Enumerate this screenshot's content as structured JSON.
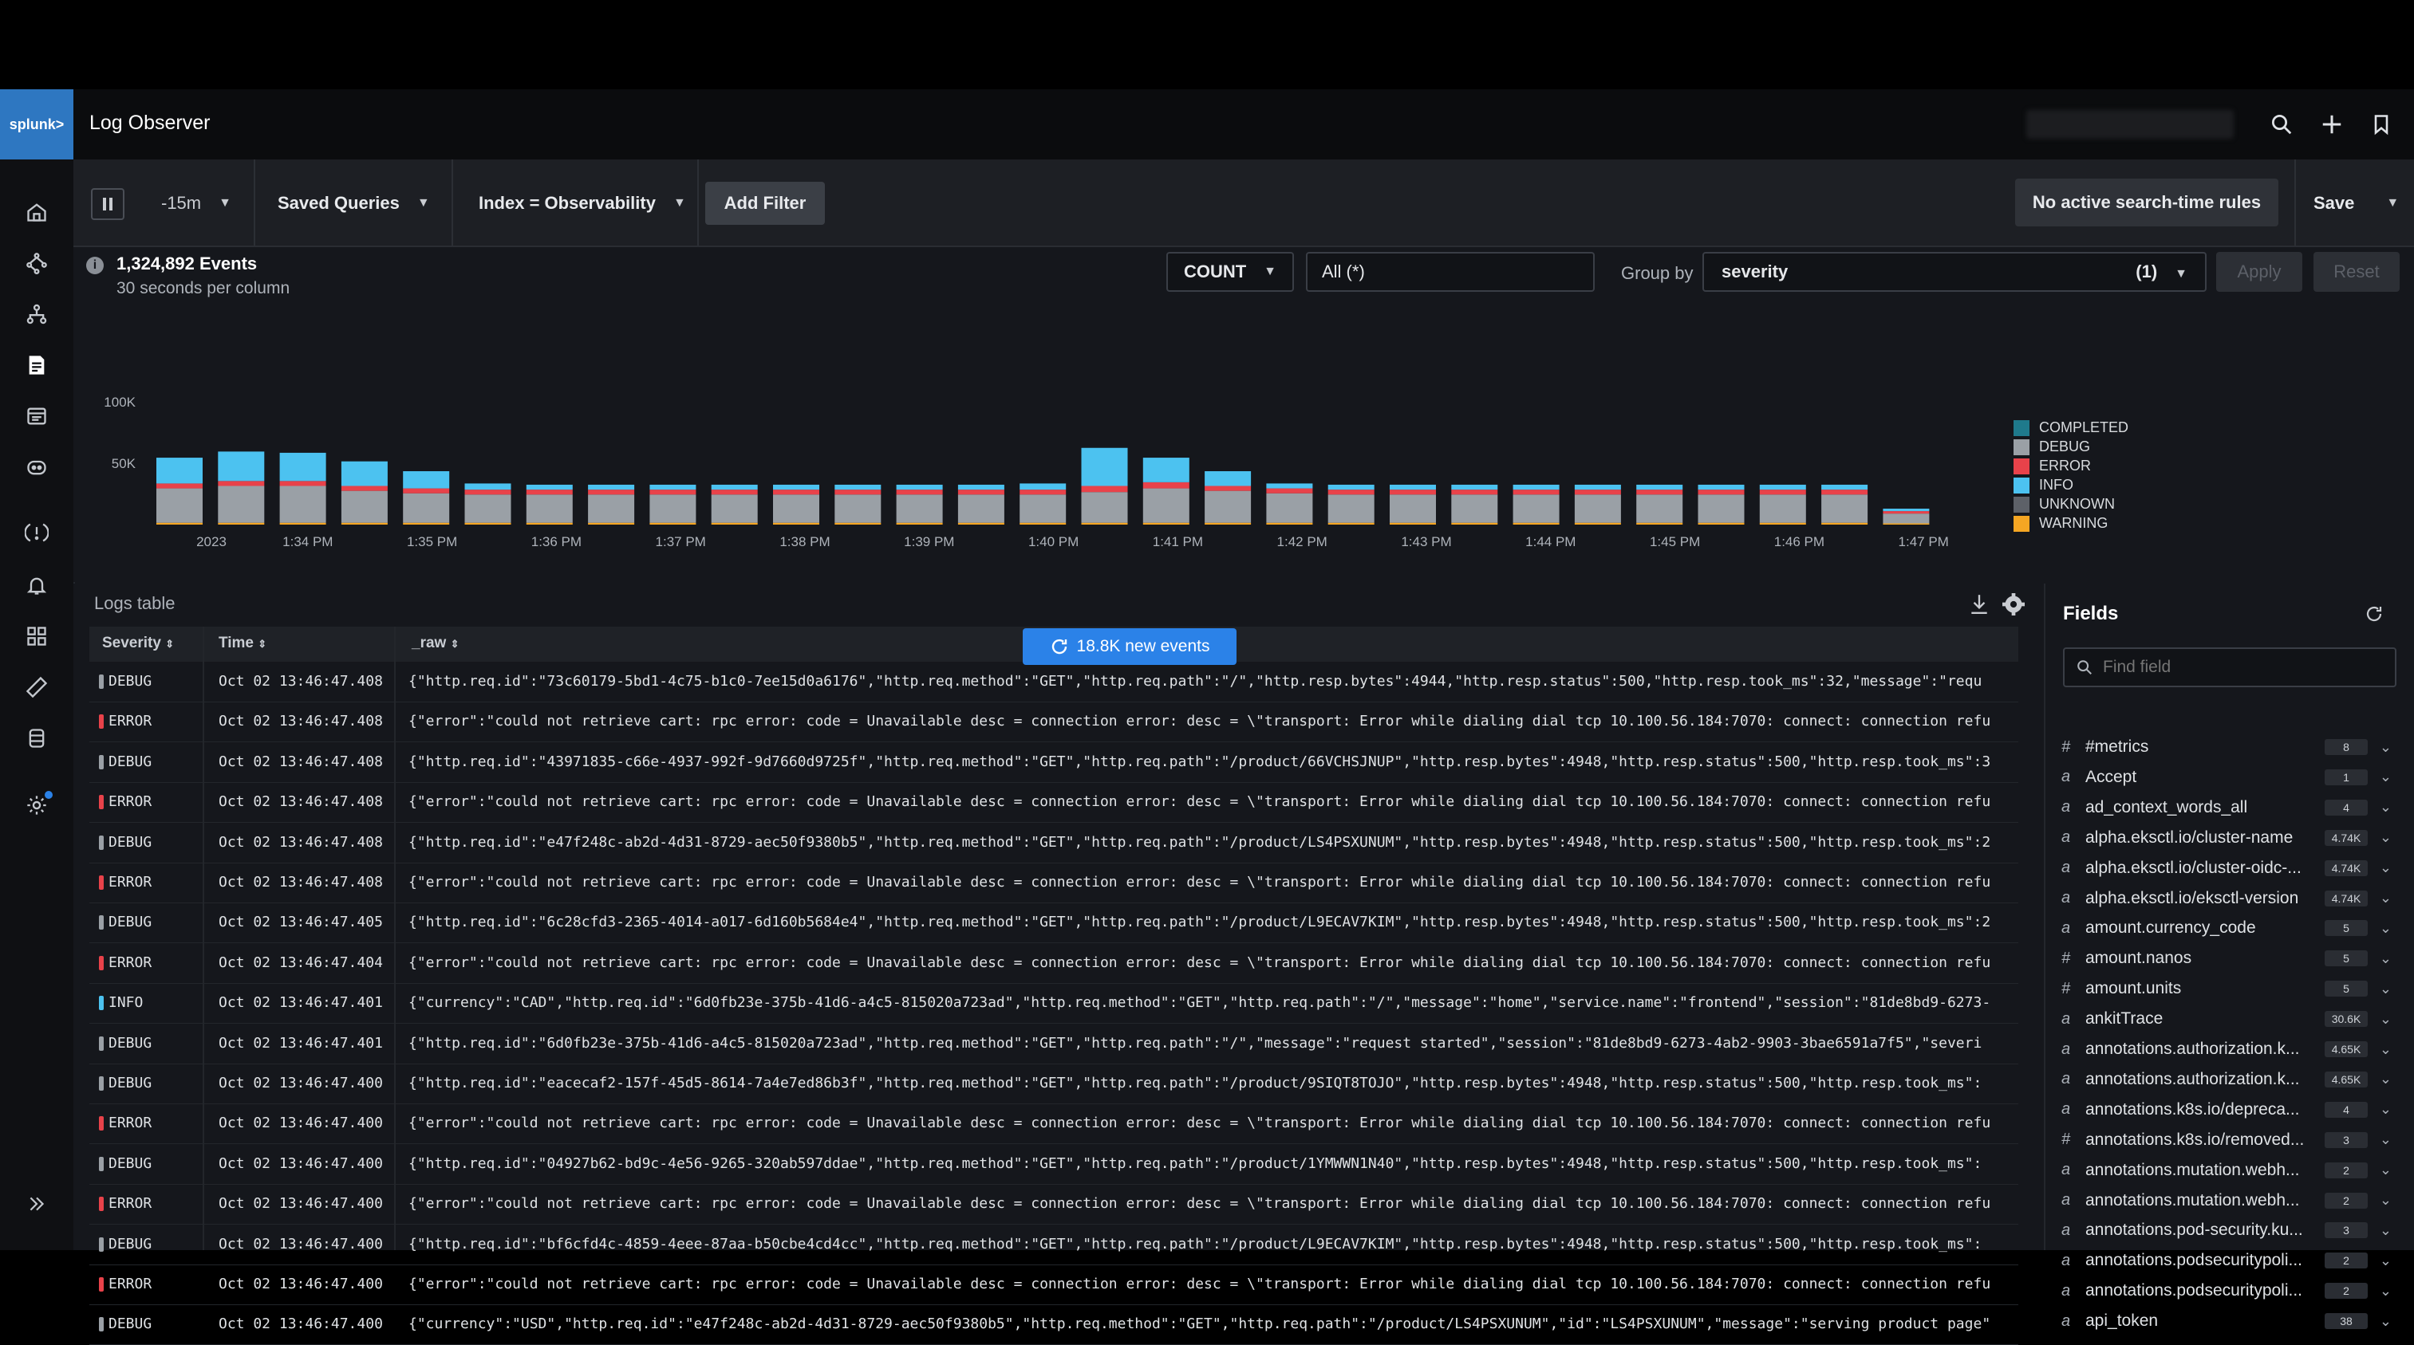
{
  "header": {
    "logo": "splunk>",
    "title": "Log Observer"
  },
  "toolbar": {
    "time_range": "-15m",
    "saved_queries": "Saved Queries",
    "index": "Index = Observability",
    "add_filter": "Add Filter",
    "rules": "No active search-time rules",
    "save": "Save"
  },
  "summary": {
    "events": "1,324,892 Events",
    "per_column": "30 seconds per column",
    "agg": "COUNT",
    "agg_target": "All (*)",
    "group_by_label": "Group by",
    "group_by": "severity",
    "group_by_count": "(1)",
    "apply": "Apply",
    "reset": "Reset"
  },
  "chart_data": {
    "type": "bar",
    "stacked": true,
    "y_ticks": [
      "100K",
      "50K"
    ],
    "ylim": [
      0,
      100000
    ],
    "x_tick_labels": [
      "2023",
      "1:34 PM",
      "1:35 PM",
      "1:36 PM",
      "1:37 PM",
      "1:38 PM",
      "1:39 PM",
      "1:40 PM",
      "1:41 PM",
      "1:42 PM",
      "1:43 PM",
      "1:44 PM",
      "1:45 PM",
      "1:46 PM",
      "1:47 PM"
    ],
    "series": [
      {
        "name": "COMPLETED",
        "color": "#1f7a8c",
        "values": [
          0,
          0,
          0,
          0,
          0,
          0,
          0,
          0,
          0,
          0,
          0,
          0,
          0,
          0,
          0,
          0,
          0,
          0,
          0,
          0,
          0,
          0,
          0,
          0,
          0,
          0,
          0,
          0,
          0
        ]
      },
      {
        "name": "DEBUG",
        "color": "#9aa0a6",
        "values": [
          28000,
          30000,
          30000,
          26000,
          24000,
          23000,
          23000,
          23000,
          23000,
          23000,
          23000,
          23000,
          23000,
          23000,
          23000,
          25000,
          28000,
          26000,
          24000,
          23000,
          23000,
          23000,
          23000,
          23000,
          23000,
          23000,
          23000,
          23000,
          8000
        ]
      },
      {
        "name": "ERROR",
        "color": "#e8424a",
        "values": [
          4000,
          4000,
          4000,
          4000,
          4000,
          4000,
          4000,
          4000,
          4000,
          4000,
          4000,
          4000,
          4000,
          4000,
          4000,
          5000,
          5000,
          4000,
          4000,
          4000,
          4000,
          4000,
          4000,
          4000,
          4000,
          4000,
          4000,
          4000,
          2000
        ]
      },
      {
        "name": "INFO",
        "color": "#4cc2f0",
        "values": [
          21000,
          24000,
          23000,
          20000,
          14000,
          5000,
          4000,
          4000,
          4000,
          4000,
          4000,
          4000,
          4000,
          4000,
          5000,
          31000,
          20000,
          12000,
          4000,
          4000,
          4000,
          4000,
          4000,
          4000,
          4000,
          4000,
          4000,
          4000,
          2000
        ]
      },
      {
        "name": "UNKNOWN",
        "color": "#5d6168",
        "values": [
          0,
          0,
          0,
          0,
          0,
          0,
          0,
          0,
          0,
          0,
          0,
          0,
          0,
          0,
          0,
          0,
          0,
          0,
          0,
          0,
          0,
          0,
          0,
          0,
          0,
          0,
          0,
          0,
          0
        ]
      },
      {
        "name": "WARNING",
        "color": "#f5a623",
        "values": [
          1500,
          1500,
          1500,
          1500,
          1500,
          1500,
          1500,
          1500,
          1500,
          1500,
          1500,
          1500,
          1500,
          1500,
          1500,
          1500,
          1500,
          1500,
          1500,
          1500,
          1500,
          1500,
          1500,
          1500,
          1500,
          1500,
          1500,
          1500,
          1000
        ]
      }
    ]
  },
  "logs": {
    "title": "Logs table",
    "columns": [
      "Severity",
      "Time",
      "_raw"
    ],
    "new_events": "18.8K new events",
    "rows": [
      {
        "severity": "DEBUG",
        "time": "Oct 02 13:46:47.408",
        "raw": "{\"http.req.id\":\"73c60179-5bd1-4c75-b1c0-7ee15d0a6176\",\"http.req.method\":\"GET\",\"http.req.path\":\"/\",\"http.resp.bytes\":4944,\"http.resp.status\":500,\"http.resp.took_ms\":32,\"message\":\"requ"
      },
      {
        "severity": "ERROR",
        "time": "Oct 02 13:46:47.408",
        "raw": "{\"error\":\"could not retrieve cart: rpc error: code = Unavailable desc = connection error: desc = \\\"transport: Error while dialing dial tcp 10.100.56.184:7070: connect: connection refu"
      },
      {
        "severity": "DEBUG",
        "time": "Oct 02 13:46:47.408",
        "raw": "{\"http.req.id\":\"43971835-c66e-4937-992f-9d7660d9725f\",\"http.req.method\":\"GET\",\"http.req.path\":\"/product/66VCHSJNUP\",\"http.resp.bytes\":4948,\"http.resp.status\":500,\"http.resp.took_ms\":3"
      },
      {
        "severity": "ERROR",
        "time": "Oct 02 13:46:47.408",
        "raw": "{\"error\":\"could not retrieve cart: rpc error: code = Unavailable desc = connection error: desc = \\\"transport: Error while dialing dial tcp 10.100.56.184:7070: connect: connection refu"
      },
      {
        "severity": "DEBUG",
        "time": "Oct 02 13:46:47.408",
        "raw": "{\"http.req.id\":\"e47f248c-ab2d-4d31-8729-aec50f9380b5\",\"http.req.method\":\"GET\",\"http.req.path\":\"/product/LS4PSXUNUM\",\"http.resp.bytes\":4948,\"http.resp.status\":500,\"http.resp.took_ms\":2"
      },
      {
        "severity": "ERROR",
        "time": "Oct 02 13:46:47.408",
        "raw": "{\"error\":\"could not retrieve cart: rpc error: code = Unavailable desc = connection error: desc = \\\"transport: Error while dialing dial tcp 10.100.56.184:7070: connect: connection refu"
      },
      {
        "severity": "DEBUG",
        "time": "Oct 02 13:46:47.405",
        "raw": "{\"http.req.id\":\"6c28cfd3-2365-4014-a017-6d160b5684e4\",\"http.req.method\":\"GET\",\"http.req.path\":\"/product/L9ECAV7KIM\",\"http.resp.bytes\":4948,\"http.resp.status\":500,\"http.resp.took_ms\":2"
      },
      {
        "severity": "ERROR",
        "time": "Oct 02 13:46:47.404",
        "raw": "{\"error\":\"could not retrieve cart: rpc error: code = Unavailable desc = connection error: desc = \\\"transport: Error while dialing dial tcp 10.100.56.184:7070: connect: connection refu"
      },
      {
        "severity": "INFO",
        "time": "Oct 02 13:46:47.401",
        "raw": "{\"currency\":\"CAD\",\"http.req.id\":\"6d0fb23e-375b-41d6-a4c5-815020a723ad\",\"http.req.method\":\"GET\",\"http.req.path\":\"/\",\"message\":\"home\",\"service.name\":\"frontend\",\"session\":\"81de8bd9-6273-"
      },
      {
        "severity": "DEBUG",
        "time": "Oct 02 13:46:47.401",
        "raw": "{\"http.req.id\":\"6d0fb23e-375b-41d6-a4c5-815020a723ad\",\"http.req.method\":\"GET\",\"http.req.path\":\"/\",\"message\":\"request started\",\"session\":\"81de8bd9-6273-4ab2-9903-3bae6591a7f5\",\"severi"
      },
      {
        "severity": "DEBUG",
        "time": "Oct 02 13:46:47.400",
        "raw": "{\"http.req.id\":\"eacecaf2-157f-45d5-8614-7a4e7ed86b3f\",\"http.req.method\":\"GET\",\"http.req.path\":\"/product/9SIQT8TOJO\",\"http.resp.bytes\":4948,\"http.resp.status\":500,\"http.resp.took_ms\":"
      },
      {
        "severity": "ERROR",
        "time": "Oct 02 13:46:47.400",
        "raw": "{\"error\":\"could not retrieve cart: rpc error: code = Unavailable desc = connection error: desc = \\\"transport: Error while dialing dial tcp 10.100.56.184:7070: connect: connection refu"
      },
      {
        "severity": "DEBUG",
        "time": "Oct 02 13:46:47.400",
        "raw": "{\"http.req.id\":\"04927b62-bd9c-4e56-9265-320ab597ddae\",\"http.req.method\":\"GET\",\"http.req.path\":\"/product/1YMWWN1N40\",\"http.resp.bytes\":4948,\"http.resp.status\":500,\"http.resp.took_ms\":"
      },
      {
        "severity": "ERROR",
        "time": "Oct 02 13:46:47.400",
        "raw": "{\"error\":\"could not retrieve cart: rpc error: code = Unavailable desc = connection error: desc = \\\"transport: Error while dialing dial tcp 10.100.56.184:7070: connect: connection refu"
      },
      {
        "severity": "DEBUG",
        "time": "Oct 02 13:46:47.400",
        "raw": "{\"http.req.id\":\"bf6cfd4c-4859-4eee-87aa-b50cbe4cd4cc\",\"http.req.method\":\"GET\",\"http.req.path\":\"/product/L9ECAV7KIM\",\"http.resp.bytes\":4948,\"http.resp.status\":500,\"http.resp.took_ms\":"
      },
      {
        "severity": "ERROR",
        "time": "Oct 02 13:46:47.400",
        "raw": "{\"error\":\"could not retrieve cart: rpc error: code = Unavailable desc = connection error: desc = \\\"transport: Error while dialing dial tcp 10.100.56.184:7070: connect: connection refu"
      },
      {
        "severity": "DEBUG",
        "time": "Oct 02 13:46:47.400",
        "raw": "{\"currency\":\"USD\",\"http.req.id\":\"e47f248c-ab2d-4d31-8729-aec50f9380b5\",\"http.req.method\":\"GET\",\"http.req.path\":\"/product/LS4PSXUNUM\",\"id\":\"LS4PSXUNUM\",\"message\":\"serving product page\""
      }
    ]
  },
  "fields": {
    "title": "Fields",
    "search_placeholder": "Find field",
    "items": [
      {
        "type": "#",
        "name": "#metrics",
        "count": "8"
      },
      {
        "type": "a",
        "name": "Accept",
        "count": "1"
      },
      {
        "type": "a",
        "name": "ad_context_words_all",
        "count": "4"
      },
      {
        "type": "a",
        "name": "alpha.eksctl.io/cluster-name",
        "count": "4.74K"
      },
      {
        "type": "a",
        "name": "alpha.eksctl.io/cluster-oidc-...",
        "count": "4.74K"
      },
      {
        "type": "a",
        "name": "alpha.eksctl.io/eksctl-version",
        "count": "4.74K"
      },
      {
        "type": "a",
        "name": "amount.currency_code",
        "count": "5"
      },
      {
        "type": "#",
        "name": "amount.nanos",
        "count": "5"
      },
      {
        "type": "#",
        "name": "amount.units",
        "count": "5"
      },
      {
        "type": "a",
        "name": "ankitTrace",
        "count": "30.6K"
      },
      {
        "type": "a",
        "name": "annotations.authorization.k...",
        "count": "4.65K"
      },
      {
        "type": "a",
        "name": "annotations.authorization.k...",
        "count": "4.65K"
      },
      {
        "type": "a",
        "name": "annotations.k8s.io/depreca...",
        "count": "4"
      },
      {
        "type": "#",
        "name": "annotations.k8s.io/removed...",
        "count": "3"
      },
      {
        "type": "a",
        "name": "annotations.mutation.webh...",
        "count": "2"
      },
      {
        "type": "a",
        "name": "annotations.mutation.webh...",
        "count": "2"
      },
      {
        "type": "a",
        "name": "annotations.pod-security.ku...",
        "count": "3"
      },
      {
        "type": "a",
        "name": "annotations.podsecuritypoli...",
        "count": "2"
      },
      {
        "type": "a",
        "name": "annotations.podsecuritypoli...",
        "count": "2"
      },
      {
        "type": "a",
        "name": "api_token",
        "count": "38"
      }
    ]
  },
  "colors": {
    "accent": "#2b82e8",
    "logo": "#2e77c1",
    "debug": "#9aa0a6",
    "error": "#e8424a",
    "info": "#4cc2f0"
  },
  "icons": [
    "home-icon",
    "infrastructure-icon",
    "apm-icon",
    "log-observer-icon",
    "dashboards-icon",
    "synthetics-icon",
    "incident-icon",
    "alerts-icon",
    "catalog-icon",
    "data-icon",
    "settings-icon"
  ]
}
